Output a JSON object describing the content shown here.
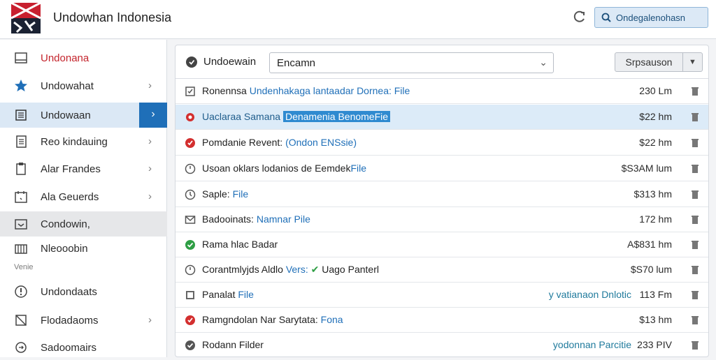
{
  "header": {
    "title": "Undowhan Indonesia",
    "search_label": "Ondegalenohasn"
  },
  "sidebar": {
    "section_label": "Venie",
    "items": [
      {
        "label": "Undonana",
        "icon": "window-icon",
        "chevron": false
      },
      {
        "label": "Undowahat",
        "icon": "star-icon",
        "chevron": true
      },
      {
        "label": "Undowaan",
        "icon": "list-icon",
        "chevron": true
      },
      {
        "label": "Reo kindauing",
        "icon": "document-icon",
        "chevron": true
      },
      {
        "label": "Alar Frandes",
        "icon": "clipboard-icon",
        "chevron": true
      },
      {
        "label": "Ala Geuerds",
        "icon": "calendar-icon",
        "chevron": true
      },
      {
        "label": "Condowin,",
        "icon": "inbox-icon",
        "chevron": false
      },
      {
        "label": "Nleooobin",
        "icon": "building-icon",
        "chevron": false
      },
      {
        "label": "Undondaats",
        "icon": "alert-icon",
        "chevron": false
      },
      {
        "label": "Flodadaoms",
        "icon": "flag-icon",
        "chevron": true
      },
      {
        "label": "Sadoomairs",
        "icon": "refresh-icon",
        "chevron": false
      }
    ]
  },
  "toolbar": {
    "label": "Undoewain",
    "select_value": "Encamn",
    "button_label": "Srpsauson"
  },
  "rows": [
    {
      "status": "document-icon",
      "name": "Ronennsa ",
      "link": "Undenhakaga lantaadar Dornea: File",
      "note": "",
      "size": "230 Lm"
    },
    {
      "status": "alert-icon",
      "name": "Uaclaraa Samana ",
      "link": "",
      "highlight": "Denamenia BenomeFie",
      "note": "",
      "size": "$22 hm"
    },
    {
      "status": "error-icon",
      "name": "Pomdanie Revent: ",
      "link": "(Ondon ENSsie)",
      "note": "",
      "size": "$22 hm"
    },
    {
      "status": "clock-icon",
      "name": "Usoan oklars lodanios de Eemdek",
      "link": "File",
      "note": "",
      "size": "$S3AM lum"
    },
    {
      "status": "clock-icon",
      "name": "Saple: ",
      "link": "File",
      "note": "",
      "size": "$313 hm"
    },
    {
      "status": "mail-icon",
      "name": "Badooinats: ",
      "link": "Namnar Pile",
      "note": "",
      "size": "172 hm"
    },
    {
      "status": "success-icon",
      "name": "Rama hlac Badar",
      "link": "",
      "note": "",
      "size": "A$831 hm"
    },
    {
      "status": "clock-icon",
      "name": "Corantmlyjds Aldlo ",
      "link": "Vers:",
      "extra": "Uago Panterl",
      "note": "",
      "size": "$S70 lum"
    },
    {
      "status": "document-icon",
      "name": "Panalat ",
      "link": "File",
      "note": "y vatianaon Dnlotic",
      "size": "113 Fm"
    },
    {
      "status": "error-icon",
      "name": "Ramgndolan Nar Sarytata: ",
      "link": "Fona",
      "note": "",
      "size": "$13 hm"
    },
    {
      "status": "success-icon",
      "name": "Rodann Filder",
      "link": "",
      "note": "yodonnan Parcitie",
      "size": "233 PIV"
    }
  ]
}
